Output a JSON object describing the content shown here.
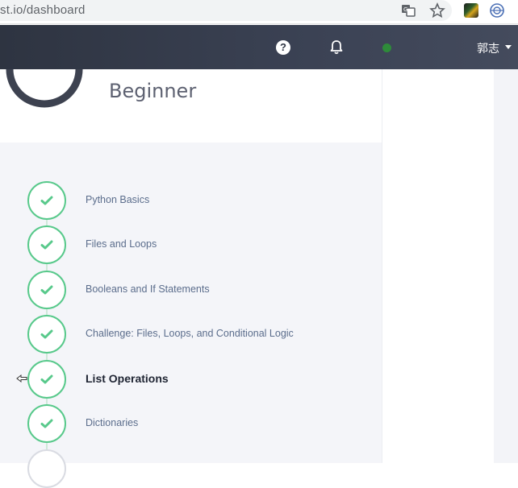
{
  "browser": {
    "url_text": "st.io/dashboard"
  },
  "header": {
    "help_icon_glyph": "?",
    "user_name": "郭志",
    "status_color": "#2e8b3a"
  },
  "course": {
    "title": "Beginner"
  },
  "steps": [
    {
      "label": "Python Basics",
      "state": "complete"
    },
    {
      "label": "Files and Loops",
      "state": "complete"
    },
    {
      "label": "Booleans and If Statements",
      "state": "complete"
    },
    {
      "label": "Challenge: Files, Loops, and Conditional Logic",
      "state": "complete"
    },
    {
      "label": "List Operations",
      "state": "current"
    },
    {
      "label": "Dictionaries",
      "state": "complete"
    }
  ],
  "colors": {
    "accent_green": "#58c98b",
    "header_bg": "#3b4254"
  }
}
